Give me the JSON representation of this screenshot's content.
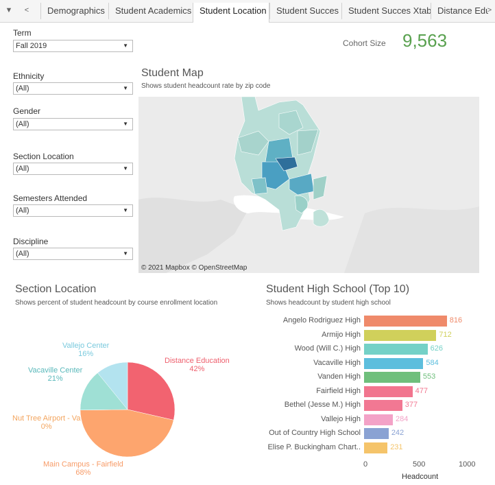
{
  "tabs": {
    "items": [
      "Demographics",
      "Student Academics",
      "Student Location",
      "Student Succes",
      "Student Succes Xtab",
      "Distance Edu"
    ],
    "active_index": 2
  },
  "filters": {
    "term": {
      "label": "Term",
      "value": "Fall 2019"
    },
    "ethnicity": {
      "label": "Ethnicity",
      "value": "(All)"
    },
    "gender": {
      "label": "Gender",
      "value": "(All)"
    },
    "section_location": {
      "label": "Section Location",
      "value": "(All)"
    },
    "semesters_attended": {
      "label": "Semesters Attended",
      "value": "(All)"
    },
    "discipline": {
      "label": "Discipline",
      "value": "(All)"
    }
  },
  "cohort": {
    "label": "Cohort Size",
    "value": "9,563",
    "color": "#59a14f"
  },
  "student_map": {
    "title": "Student Map",
    "subtitle": "Shows student headcount rate by zip code",
    "credit": "© 2021 Mapbox © OpenStreetMap"
  },
  "section_location": {
    "title": "Section Location",
    "subtitle": "Shows percent of student headcount by course enrollment location",
    "labels": {
      "vallejo": {
        "name": "Vallejo Center",
        "pct": "16%"
      },
      "vacaville": {
        "name": "Vacaville Center",
        "pct": "21%"
      },
      "distance": {
        "name": "Distance Education",
        "pct": "42%"
      },
      "nuttree": {
        "name": "Nut Tree Airport - Va",
        "pct": "0%"
      },
      "main": {
        "name": "Main Campus - Fairfield",
        "pct": "68%"
      }
    }
  },
  "high_school": {
    "title": "Student High School (Top 10)",
    "subtitle": "Shows headcount by student high school",
    "axis_title": "Headcount",
    "ticks": [
      "0",
      "500",
      "1000"
    ]
  },
  "chart_data": [
    {
      "type": "pie",
      "title": "Section Location",
      "categories": [
        "Distance Education",
        "Main Campus - Fairfield",
        "Nut Tree Airport - Va",
        "Vacaville Center",
        "Vallejo Center"
      ],
      "values": [
        42,
        68,
        0,
        21,
        16
      ],
      "colors": [
        "#f26370",
        "#fda56e",
        "#8fd17a",
        "#9fe0d5",
        "#b3e3ef"
      ]
    },
    {
      "type": "bar",
      "title": "Student High School (Top 10)",
      "categories": [
        "Angelo Rodriguez High",
        "Armijo High",
        "Wood (Will C.) High",
        "Vacaville High",
        "Vanden High",
        "Fairfield High",
        "Bethel (Jesse M.) High",
        "Vallejo High",
        "Out of Country High School",
        "Elise P. Buckingham Chart.."
      ],
      "values": [
        816,
        712,
        626,
        584,
        553,
        477,
        377,
        284,
        242,
        231
      ],
      "colors": [
        "#ef8a6a",
        "#d0d05b",
        "#74d1c7",
        "#5cbedd",
        "#6fbf7c",
        "#f1758e",
        "#f27893",
        "#f3a2c7",
        "#8aa2d3",
        "#f5c46a"
      ],
      "xlabel": "Headcount",
      "xlim": [
        0,
        1000
      ]
    }
  ]
}
